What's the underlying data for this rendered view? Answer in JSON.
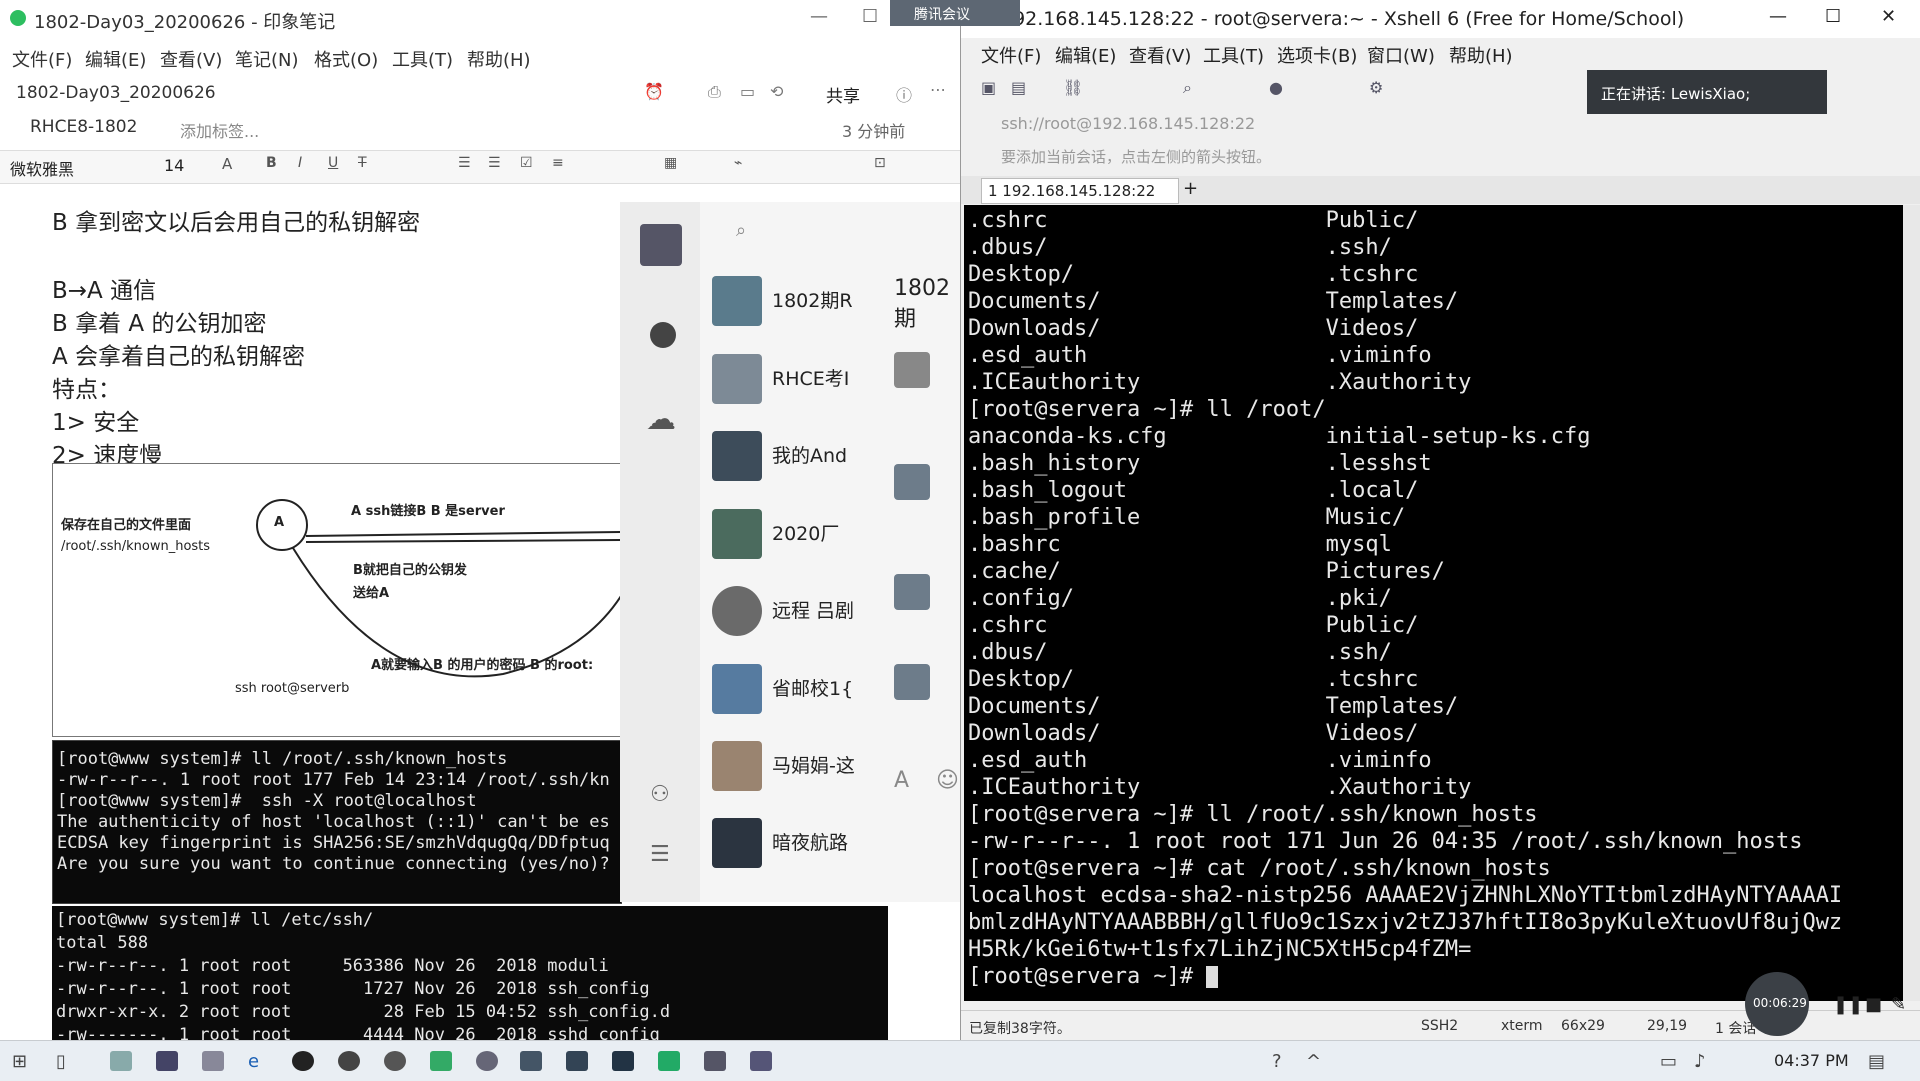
{
  "evernote": {
    "window_title": "1802-Day03_20200626 - 印象笔记",
    "menu": [
      "文件(F)",
      "编辑(E)",
      "查看(V)",
      "笔记(N)",
      "格式(O)",
      "工具(T)",
      "帮助(H)"
    ],
    "note_title": "1802-Day03_20200626",
    "share_label": "共享",
    "notebook": "RHCE8-1802",
    "add_tag": "添加标签...",
    "updated": "3 分钟前",
    "font_name": "微软雅黑",
    "font_size": "14",
    "body_lines": [
      "B 拿到密文以后会用自己的私钥解密",
      "B→A 通信",
      "B 拿着 A 的公钥加密",
      "A 会拿着自己的私钥解密",
      "特点：",
      "1> 安全",
      "2> 速度慢"
    ],
    "diagram": {
      "label_save": "保存在自己的文件里面",
      "label_path": "/root/.ssh/known_hosts",
      "node_a": "A",
      "label_connect": "A ssh链接B B 是server",
      "label_sendkey1": "B就把自己的公钥发",
      "label_sendkey2": "送给A",
      "label_password": "A就要输入B 的用户的密码 B 的root:",
      "label_cmd": "ssh  root@serverb"
    },
    "term1_lines": [
      "[root@www system]# ll /root/.ssh/known_hosts",
      "-rw-r--r--. 1 root root 177 Feb 14 23:14 /root/.ssh/kn",
      "[root@www system]#  ssh -X root@localhost",
      "The authenticity of host 'localhost (::1)' can't be es",
      "ECDSA key fingerprint is SHA256:SE/smzhVdqugQq/DDfptuq",
      "Are you sure you want to continue connecting (yes/no)?"
    ],
    "term2_lines": [
      "[root@www system]# ll /etc/ssh/",
      "total 588",
      "-rw-r--r--. 1 root root     563386 Nov 26  2018 moduli",
      "-rw-r--r--. 1 root root       1727 Nov 26  2018 ssh_config",
      "drwxr-xr-x. 2 root root         28 Feb 15 04:52 ssh_config.d",
      "-rw-------. 1 root root       4444 Nov 26  2018 sshd_config"
    ]
  },
  "chat": {
    "header_title": "1802期",
    "items": [
      {
        "name": "1802期R",
        "color": "#5a7b8c"
      },
      {
        "name": "RHCE考I",
        "color": "#7d8a96"
      },
      {
        "name": "我的And",
        "color": "#3d4c5a"
      },
      {
        "name": "2020厂",
        "color": "#4b6b5e"
      },
      {
        "name": "远程 吕剧",
        "color": "#6a6a6a"
      },
      {
        "name": "省邮校1{",
        "color": "#567ba0"
      },
      {
        "name": "马娟娟-这",
        "color": "#9a8470"
      },
      {
        "name": "暗夜航路",
        "color": "#2b3440"
      }
    ]
  },
  "meeting": {
    "title": "腾讯会议",
    "speaking": "正在讲话: LewisXiao;",
    "timer": "00:06:29"
  },
  "xshell": {
    "window_title": "192.168.145.128:22 - root@servera:~ - Xshell 6 (Free for Home/School)",
    "menu": [
      "文件(F)",
      "编辑(E)",
      "查看(V)",
      "工具(T)",
      "选项卡(B)",
      "窗口(W)",
      "帮助(H)"
    ],
    "address": "ssh://root@192.168.145.128:22",
    "hint": "要添加当前会话，点击左侧的箭头按钮。",
    "tab_label": "1 192.168.145.128:22",
    "term_lines": [
      ".cshrc                     Public/",
      ".dbus/                     .ssh/",
      "Desktop/                   .tcshrc",
      "Documents/                 Templates/",
      "Downloads/                 Videos/",
      ".esd_auth                  .viminfo",
      ".ICEauthority              .Xauthority",
      "[root@servera ~]# ll /root/",
      "anaconda-ks.cfg            initial-setup-ks.cfg",
      ".bash_history              .lesshst",
      ".bash_logout               .local/",
      ".bash_profile              Music/",
      ".bashrc                    mysql",
      ".cache/                    Pictures/",
      ".config/                   .pki/",
      ".cshrc                     Public/",
      ".dbus/                     .ssh/",
      "Desktop/                   .tcshrc",
      "Documents/                 Templates/",
      "Downloads/                 Videos/",
      ".esd_auth                  .viminfo",
      ".ICEauthority              .Xauthority",
      "[root@servera ~]# ll /root/.ssh/known_hosts",
      "-rw-r--r--. 1 root root 171 Jun 26 04:35 /root/.ssh/known_hosts",
      "[root@servera ~]# cat /root/.ssh/known_hosts",
      "localhost ecdsa-sha2-nistp256 AAAAE2VjZHNhLXNoYTItbmlzdHAyNTYAAAAI",
      "bmlzdHAyNTYAAABBBH/gllfUo9c1Szxjv2tZJ37hftII8o3pyKuleXtuovUf8ujQwz",
      "H5Rk/kGei6tw+t1sfx7LihZjNC5XtH5cp4fZM=",
      "[root@servera ~]# "
    ],
    "status": {
      "copied": "已复制38字符。",
      "protocol": "SSH2",
      "term": "xterm",
      "size": "66x29",
      "cursor": "29,19",
      "sessions": "1 会话"
    }
  },
  "taskbar": {
    "time": "04:37 PM"
  }
}
